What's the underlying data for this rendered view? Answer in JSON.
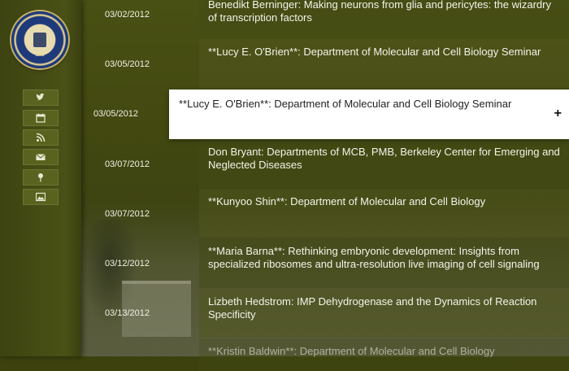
{
  "sidebar": {
    "seal_year": "1868",
    "icons": [
      "twitter-icon",
      "calendar-icon",
      "rss-icon",
      "mail-icon",
      "location-pin-icon",
      "photo-icon"
    ]
  },
  "events": [
    {
      "date": "03/02/2012",
      "title": "Benedikt Berninger: Making neurons from glia and pericytes: the wizardry of transcription factors"
    },
    {
      "date": "03/05/2012",
      "title": "**Lucy E. O'Brien**: Department of Molecular and Cell Biology Seminar"
    },
    {
      "date": "03/05/2012",
      "title": "**Lucy E. O'Brien**: Department of Molecular and Cell Biology Seminar",
      "expand_label": "+"
    },
    {
      "date": "03/07/2012",
      "title": "Don Bryant: Departments of MCB, PMB, Berkeley Center for Emerging and Neglected Diseases"
    },
    {
      "date": "03/07/2012",
      "title": "**Kunyoo Shin**: Department of Molecular and Cell Biology"
    },
    {
      "date": "03/12/2012",
      "title": "**Maria Barna**: Rethinking embryonic development: Insights from specialized ribosomes and ultra-resolution live imaging of cell signaling"
    },
    {
      "date": "03/13/2012",
      "title": "Lizbeth Hedstrom: IMP Dehydrogenase and the Dynamics of Reaction Specificity"
    },
    {
      "date": "",
      "title": "**Kristin Baldwin**: Department of Molecular and Cell Biology"
    }
  ]
}
